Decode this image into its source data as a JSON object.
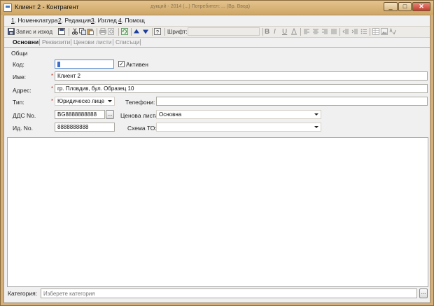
{
  "window": {
    "title": "Клиент 2 - Контрагент",
    "faded_title": "дукций - 2014 (...) Потребител: ... (Вр. Ввод)",
    "minimize": "_",
    "maximize": "□",
    "close": "✕"
  },
  "menu": [
    {
      "key": "1",
      "label": ". Номенклатура"
    },
    {
      "key": "2",
      "label": ". Редакция"
    },
    {
      "key": "3",
      "label": ". Изглед"
    },
    {
      "key": "4",
      "label": ". Помощ"
    }
  ],
  "toolbar": {
    "save_close_label": "Запис и изход",
    "font_label": "Шрифт:",
    "font_value": "",
    "bold": "B",
    "italic": "I",
    "underline": "U"
  },
  "tabs": [
    {
      "label": "Основни",
      "active": true
    },
    {
      "label": "Реквизити",
      "active": false
    },
    {
      "label": "Ценови листи",
      "active": false
    },
    {
      "label": "Списъци",
      "active": false
    }
  ],
  "form": {
    "group_label": "Общи",
    "code": {
      "label": "Код:",
      "value": "",
      "active_checkbox_label": "Активен",
      "active_checked": true
    },
    "name": {
      "label": "Име:",
      "value": "Клиент 2",
      "required_mark": "*"
    },
    "address": {
      "label": "Адрес:",
      "value": "гр. Пловдив, бул. Образец 10",
      "required_mark": "*"
    },
    "type": {
      "label": "Тип:",
      "value": "Юридическо лице",
      "required_mark": "*"
    },
    "phones": {
      "label": "Телефони:",
      "value": ""
    },
    "vat": {
      "label": "ДДС No.",
      "value": "BG8888888888",
      "browse": "..."
    },
    "price_list": {
      "label": "Ценова листа:",
      "value": "Основна"
    },
    "id_no": {
      "label": "Ид. No.",
      "value": "8888888888"
    },
    "scheme": {
      "label": "Схема ТО:",
      "value": ""
    }
  },
  "category": {
    "label": "Категория:",
    "placeholder": "Изберете категория",
    "browse": "..."
  }
}
